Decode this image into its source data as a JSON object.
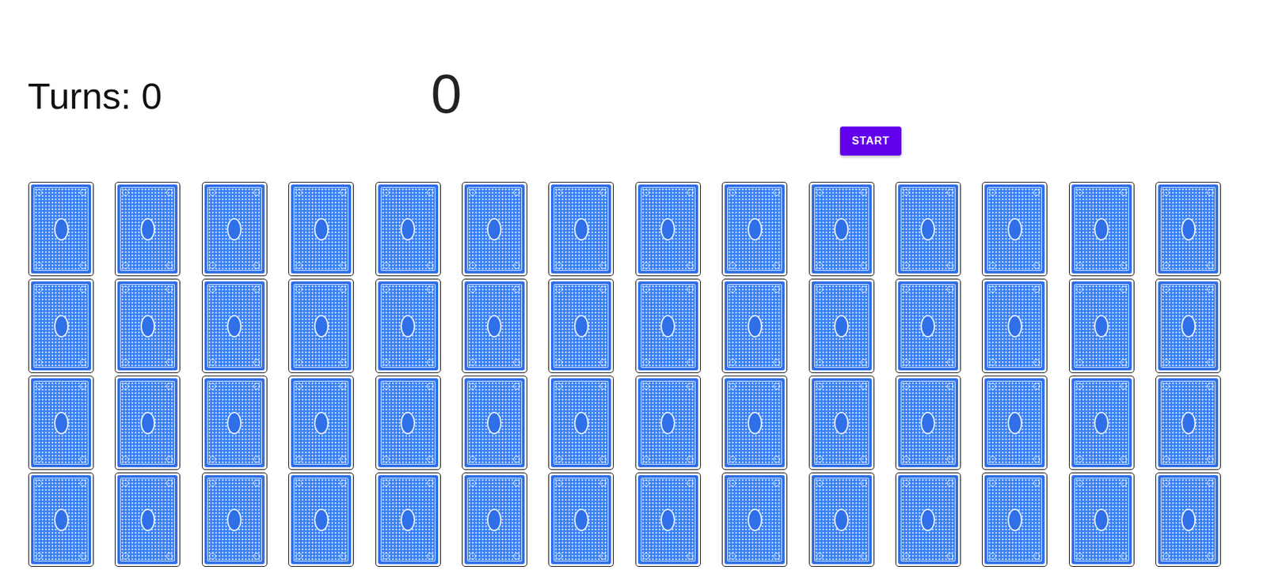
{
  "turns": "Turns: 0",
  "timer": "0",
  "start_button": "START",
  "cards": [
    {
      "face_up": false
    },
    {
      "face_up": false
    },
    {
      "face_up": false
    },
    {
      "face_up": false
    },
    {
      "face_up": false
    },
    {
      "face_up": false
    },
    {
      "face_up": false
    },
    {
      "face_up": false
    },
    {
      "face_up": false
    },
    {
      "face_up": false
    },
    {
      "face_up": false
    },
    {
      "face_up": false
    },
    {
      "face_up": false
    },
    {
      "face_up": false
    },
    {
      "face_up": false
    },
    {
      "face_up": false
    },
    {
      "face_up": false
    },
    {
      "face_up": false
    },
    {
      "face_up": false
    },
    {
      "face_up": false
    },
    {
      "face_up": false
    },
    {
      "face_up": false
    },
    {
      "face_up": false
    },
    {
      "face_up": false
    },
    {
      "face_up": false
    },
    {
      "face_up": false
    },
    {
      "face_up": false
    },
    {
      "face_up": false
    },
    {
      "face_up": false
    },
    {
      "face_up": false
    },
    {
      "face_up": false
    },
    {
      "face_up": false
    },
    {
      "face_up": false
    },
    {
      "face_up": false
    },
    {
      "face_up": false
    },
    {
      "face_up": false
    },
    {
      "face_up": false
    },
    {
      "face_up": false
    },
    {
      "face_up": false
    },
    {
      "face_up": false
    },
    {
      "face_up": false
    },
    {
      "face_up": false
    },
    {
      "face_up": false
    },
    {
      "face_up": false
    },
    {
      "face_up": false
    },
    {
      "face_up": false
    },
    {
      "face_up": false
    },
    {
      "face_up": false
    },
    {
      "face_up": false
    },
    {
      "face_up": false
    },
    {
      "face_up": false
    },
    {
      "face_up": false
    },
    {
      "face_up": false
    },
    {
      "face_up": false
    },
    {
      "face_up": false
    },
    {
      "face_up": false
    }
  ]
}
